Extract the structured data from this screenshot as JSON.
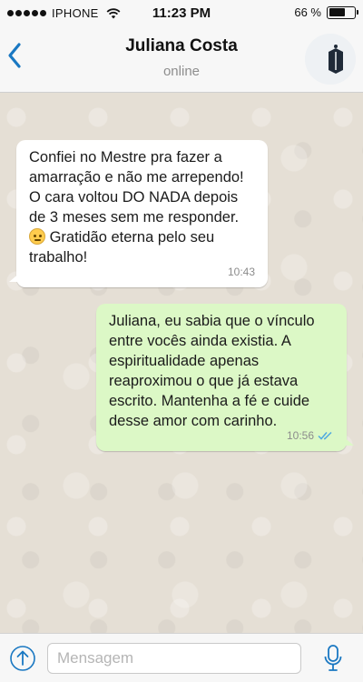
{
  "status_bar": {
    "carrier": "IPHONE",
    "time": "11:23 PM",
    "battery": "66 %",
    "battery_level": 0.66
  },
  "header": {
    "contact_name": "Juliana Costa",
    "contact_status": "online"
  },
  "messages": [
    {
      "direction": "incoming",
      "text_before_emoji": "Confiei no Mestre pra fazer a amarração e não me arrependo! O cara voltou DO NADA depois de 3 meses sem me responder.",
      "emoji": "slightly-smiling-face",
      "text_after_emoji": "Gratidão eterna pelo seu trabalho!",
      "time": "10:43"
    },
    {
      "direction": "outgoing",
      "text": "Juliana, eu sabia que o vínculo entre vocês ainda existia. A espiritualidade apenas reaproximou o que já estava escrito. Mantenha a fé e cuide desse amor com carinho.",
      "time": "10:56",
      "status": "read"
    }
  ],
  "composer": {
    "placeholder": "Mensagem"
  },
  "colors": {
    "accent": "#1a78c2",
    "incoming_bubble": "#ffffff",
    "outgoing_bubble": "#dcf8c6",
    "read_ticks": "#4fa9e0",
    "wallpaper": "#e5dfd5"
  },
  "icons": {
    "back": "chevron-left-icon",
    "wifi": "wifi-icon",
    "battery": "battery-icon",
    "avatar": "moon-avatar",
    "attach": "upload-arrow-icon",
    "mic": "microphone-icon",
    "read_receipt": "double-check-icon"
  }
}
